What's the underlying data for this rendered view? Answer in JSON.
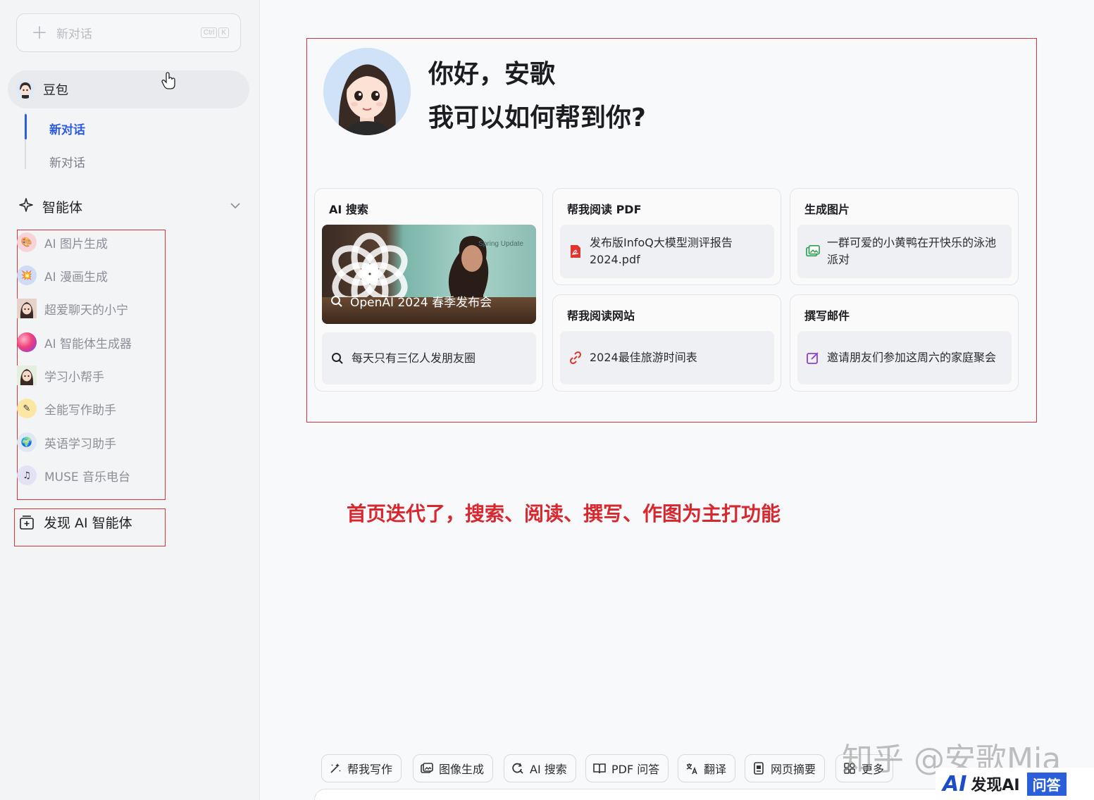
{
  "sidebar": {
    "new_chat_label": "新对话",
    "shortcut_keys": [
      "Ctrl",
      "K"
    ],
    "bot_name": "豆包",
    "sub_items": [
      {
        "label": "新对话",
        "active": true
      },
      {
        "label": "新对话",
        "active": false
      }
    ],
    "agents_title": "智能体",
    "agents": [
      {
        "label": "AI 图片生成",
        "icon": "palette-icon",
        "color": "#f8d3d8"
      },
      {
        "label": "AI 漫画生成",
        "icon": "comic-icon",
        "color": "#cfdcf6"
      },
      {
        "label": "超爱聊天的小宁",
        "icon": "girl-avatar-icon",
        "color": "#e6d2c8"
      },
      {
        "label": "AI 智能体生成器",
        "icon": "gradient-orb-icon",
        "color": "#f05a8c"
      },
      {
        "label": "学习小帮手",
        "icon": "student-avatar-icon",
        "color": "#e5efe0"
      },
      {
        "label": "全能写作助手",
        "icon": "pencil-icon",
        "color": "#fbe7a3"
      },
      {
        "label": "英语学习助手",
        "icon": "globe-icon",
        "color": "#e0e8f4"
      },
      {
        "label": "MUSE 音乐电台",
        "icon": "music-note-icon",
        "color": "#e3e2f5"
      }
    ],
    "discover_label": "发现 AI 智能体"
  },
  "hero": {
    "greeting_line1": "你好，安歌",
    "greeting_line2": "我可以如何帮到你?"
  },
  "cards": {
    "ai_search": {
      "title": "AI 搜索",
      "news_caption": "OpenAI 2024 春季发布会",
      "news_stage_text": "Spring  Update",
      "query": "每天只有三亿人发朋友圈"
    },
    "read_pdf": {
      "title": "帮我阅读 PDF",
      "item": "发布版InfoQ大模型测评报告2024.pdf"
    },
    "gen_image": {
      "title": "生成图片",
      "item": "一群可爱的小黄鸭在开快乐的泳池派对"
    },
    "read_web": {
      "title": "帮我阅读网站",
      "item": "2024最佳旅游时间表"
    },
    "write_mail": {
      "title": "撰写邮件",
      "item": "邀请朋友们参加这周六的家庭聚会"
    }
  },
  "annotation": "首页迭代了，搜索、阅读、撰写、作图为主打功能",
  "toolbar": [
    {
      "label": "帮我写作",
      "icon": "magic-pen-icon"
    },
    {
      "label": "图像生成",
      "icon": "image-icon"
    },
    {
      "label": "AI 搜索",
      "icon": "search-refresh-icon"
    },
    {
      "label": "PDF 问答",
      "icon": "book-icon"
    },
    {
      "label": "翻译",
      "icon": "translate-icon"
    },
    {
      "label": "网页摘要",
      "icon": "document-icon"
    },
    {
      "label": "更多",
      "icon": "grid-icon"
    }
  ],
  "watermark": "知乎 @安歌Mia",
  "logo": {
    "ai": "AI",
    "name": "发现AI",
    "tag": "问答"
  },
  "colors": {
    "accent": "#2d5be3",
    "annotation_red": "#d8282f"
  }
}
